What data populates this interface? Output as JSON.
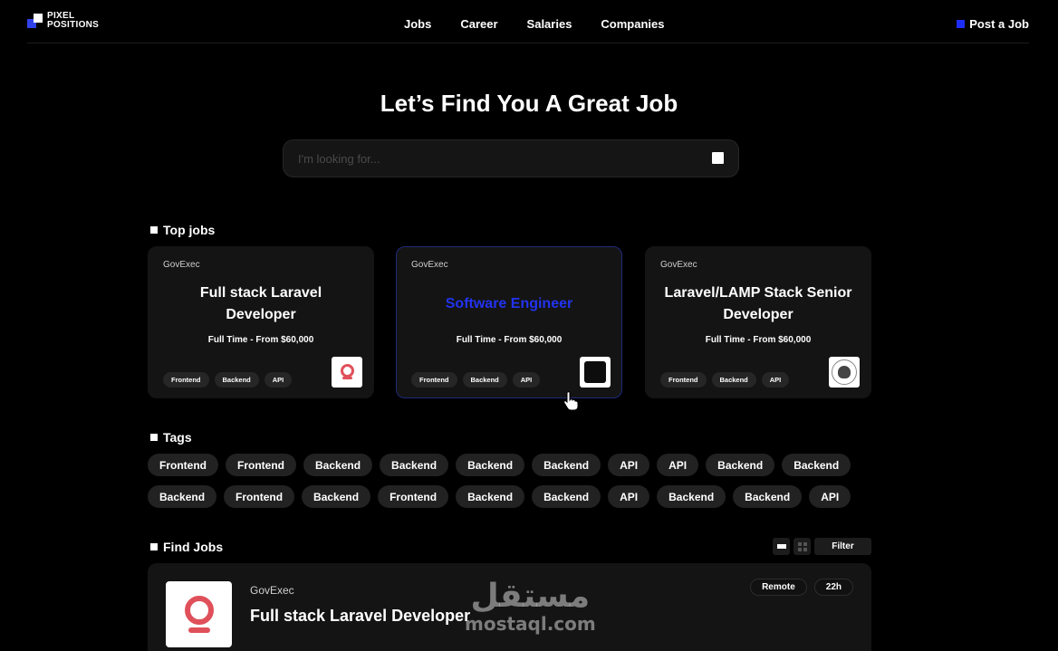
{
  "brand": {
    "line1": "PIXEL",
    "line2": "POSITIONS"
  },
  "nav": {
    "links": [
      "Jobs",
      "Career",
      "Salaries",
      "Companies"
    ],
    "post_job": "Post a Job"
  },
  "hero": {
    "title": "Let’s Find You A Great Job",
    "search_placeholder": "I'm looking for..."
  },
  "top_jobs": {
    "heading": "Top jobs",
    "cards": [
      {
        "employer": "GovExec",
        "title": "Full stack Laravel Developer",
        "meta": "Full Time - From $60,000",
        "tags": [
          "Frontend",
          "Backend",
          "API"
        ],
        "logo": "ring-logo"
      },
      {
        "employer": "GovExec",
        "title": "Software Engineer",
        "meta": "Full Time - From $60,000",
        "tags": [
          "Frontend",
          "Backend",
          "API"
        ],
        "logo": "dark-square-logo"
      },
      {
        "employer": "GovExec",
        "title": "Laravel/LAMP Stack Senior Developer",
        "meta": "Full Time - From $60,000",
        "tags": [
          "Frontend",
          "Backend",
          "API"
        ],
        "logo": "tree-seal-logo"
      }
    ]
  },
  "tags": {
    "heading": "Tags",
    "row1": [
      "Frontend",
      "Frontend",
      "Backend",
      "Backend",
      "Backend",
      "Backend",
      "API",
      "API",
      "Backend",
      "Backend"
    ],
    "row2": [
      "Backend",
      "Frontend",
      "Backend",
      "Frontend",
      "Backend",
      "Backend",
      "API",
      "Backend",
      "Backend",
      "API"
    ]
  },
  "find_jobs": {
    "heading": "Find Jobs",
    "filter_label": "Filter",
    "row": {
      "employer": "GovExec",
      "title": "Full stack Laravel Developer",
      "pills": [
        "Remote",
        "22h"
      ]
    }
  },
  "watermark": {
    "arabic": "مستقل",
    "latin": "mostaql.com"
  },
  "colors": {
    "accent": "#1d2dfb",
    "logo_red": "#e0505a",
    "card_bg": "#141414"
  }
}
